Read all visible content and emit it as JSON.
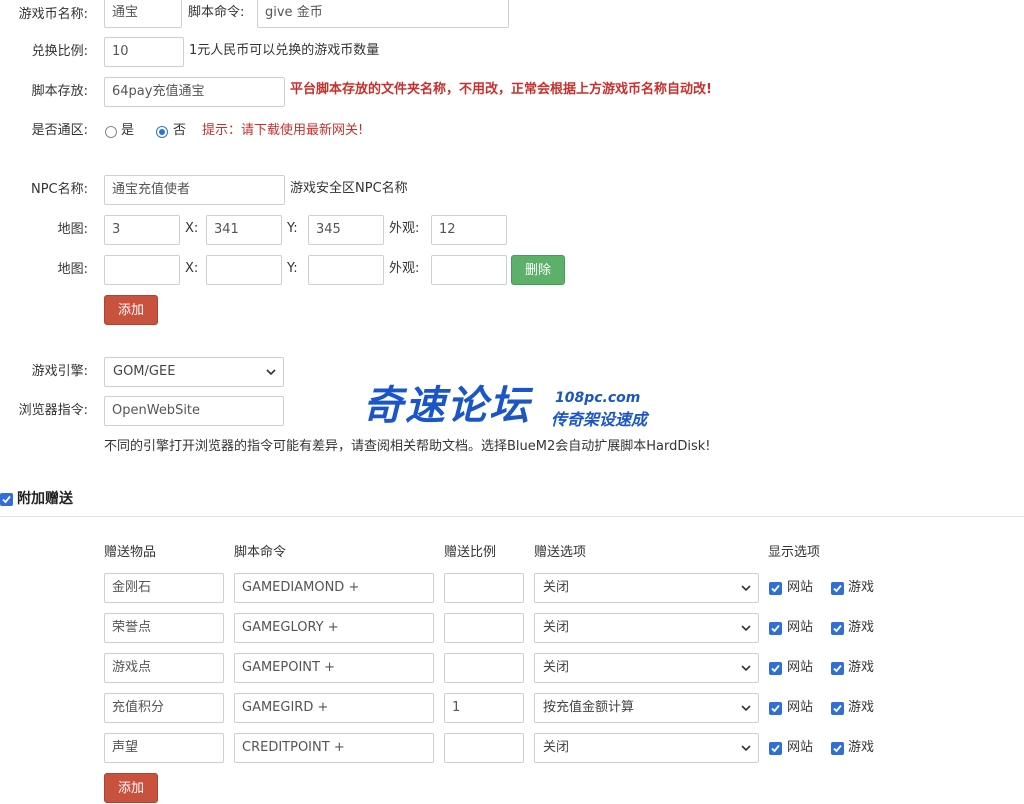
{
  "form": {
    "coin_name_label": "游戏币名称:",
    "coin_name_value": "通宝",
    "script_cmd_label": "脚本命令:",
    "script_cmd_value": "give 金币",
    "ratio_label": "兑换比例:",
    "ratio_value": "10",
    "ratio_hint": "1元人民币可以兑换的游戏币数量",
    "storage_label": "脚本存放:",
    "storage_value": "64pay充值通宝",
    "storage_hint": "平台脚本存放的文件夹名称，不用改，正常会根据上方游戏币名称自动改!",
    "tongqu_label": "是否通区:",
    "tongqu_yes": "是",
    "tongqu_no": "否",
    "tongqu_hint": "提示：请下载使用最新网关!",
    "npc_label": "NPC名称:",
    "npc_value": "通宝充值使者",
    "npc_hint": "游戏安全区NPC名称",
    "map_label": "地图:",
    "x_label": "X:",
    "y_label": "Y:",
    "look_label": "外观:",
    "map_rows": [
      {
        "map": "3",
        "x": "341",
        "y": "345",
        "look": "12"
      },
      {
        "map": "",
        "x": "",
        "y": "",
        "look": ""
      }
    ],
    "delete_button": "删除",
    "add_button": "添加",
    "engine_label": "游戏引擎:",
    "engine_value": "GOM/GEE",
    "browser_label": "浏览器指令:",
    "browser_value": "OpenWebSite",
    "browser_hint": "不同的引擎打开浏览器的指令可能有差异，请查阅相关帮助文档。选择BlueM2会自动扩展脚本HardDisk!"
  },
  "bonus": {
    "section_title": "附加赠送",
    "headers": [
      "赠送物品",
      "脚本命令",
      "赠送比例",
      "赠送选项",
      "显示选项"
    ],
    "site_label": "网站",
    "game_label": "游戏",
    "rows": [
      {
        "item": "金刚石",
        "cmd": "GAMEDIAMOND +",
        "ratio": "",
        "option": "关闭"
      },
      {
        "item": "荣誉点",
        "cmd": "GAMEGLORY +",
        "ratio": "",
        "option": "关闭"
      },
      {
        "item": "游戏点",
        "cmd": "GAMEPOINT +",
        "ratio": "",
        "option": "关闭"
      },
      {
        "item": "充值积分",
        "cmd": "GAMEGIRD +",
        "ratio": "1",
        "option": "按充值金额计算"
      },
      {
        "item": "声望",
        "cmd": "CREDITPOINT +",
        "ratio": "",
        "option": "关闭"
      }
    ],
    "add_button": "添加"
  },
  "watermark": {
    "main": "奇速论坛",
    "domain": "108pc.com",
    "sub": "传奇架设速成"
  },
  "colors": {
    "accent_blue": "#2f6fd6",
    "danger_red": "#c9302c",
    "add_button": "#c9523f",
    "delete_button": "#5cb06a"
  }
}
